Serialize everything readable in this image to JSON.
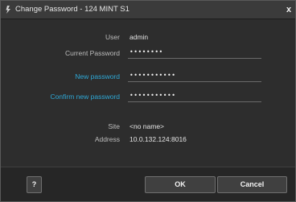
{
  "window": {
    "title": "Change Password - 124 MINT S1",
    "close_glyph": "x",
    "icon": "app-icon"
  },
  "form": {
    "user": {
      "label": "User",
      "value": "admin"
    },
    "current_password": {
      "label": "Current Password",
      "value": "••••••••"
    },
    "new_password": {
      "label": "New password",
      "value": "•••••••••••"
    },
    "confirm_password": {
      "label": "Confirm new password",
      "value": "•••••••••••"
    },
    "site": {
      "label": "Site",
      "value": "<no name>"
    },
    "address": {
      "label": "Address",
      "value": "10.0.132.124:8016"
    }
  },
  "buttons": {
    "help": "?",
    "ok": "OK",
    "cancel": "Cancel"
  },
  "colors": {
    "accent": "#2ea8d6",
    "background": "#2d2d2d",
    "footer": "#262626"
  }
}
